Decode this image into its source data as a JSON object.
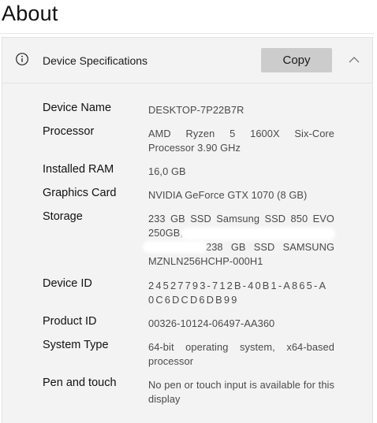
{
  "page": {
    "title": "About"
  },
  "card": {
    "title": "Device Specifications",
    "copy_label": "Copy",
    "info_icon": "info-icon",
    "collapse_icon": "chevron-up-icon"
  },
  "specs": [
    {
      "label": "Device Name",
      "value": "DESKTOP-7P22B7R"
    },
    {
      "label": "Processor",
      "value": "AMD Ryzen 5 1600X Six-Core Processor 3.90 GHz"
    },
    {
      "label": "Installed RAM",
      "value": "16,0 GB"
    },
    {
      "label": "Graphics Card",
      "value": "NVIDIA GeForce GTX 1070 (8 GB)"
    },
    {
      "label": "Storage",
      "value": "233 GB SSD Samsung SSD 850 EVO 250GB,",
      "value2": "238 GB SSD SAMSUNG MZNLN256HCHP-000H1"
    },
    {
      "label": "Device ID",
      "value": "24527793-712B-40B1-A865-A0C6DCD6DB99"
    },
    {
      "label": "Product ID",
      "value": "00326-10124-06497-AA360"
    },
    {
      "label": "System Type",
      "value": "64-bit operating system, x64-based processor"
    },
    {
      "label": "Pen and touch",
      "value": "No pen or touch input is available for this display"
    }
  ]
}
